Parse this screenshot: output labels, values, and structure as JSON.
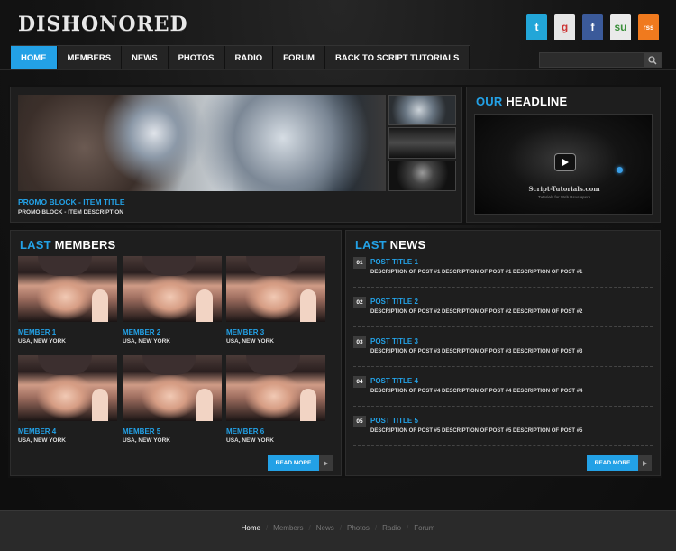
{
  "header": {
    "logo": "DISHONORED",
    "social": [
      {
        "name": "twitter",
        "glyph": "t",
        "color": "#22a6d8"
      },
      {
        "name": "google",
        "glyph": "g",
        "color": "#e6e6e6"
      },
      {
        "name": "facebook",
        "glyph": "f",
        "color": "#3b5a9a"
      },
      {
        "name": "stumbleupon",
        "glyph": "su",
        "color": "#eaeaea"
      },
      {
        "name": "rss",
        "glyph": "rss",
        "color": "#f07a1e"
      }
    ]
  },
  "nav": {
    "items": [
      "HOME",
      "MEMBERS",
      "NEWS",
      "PHOTOS",
      "RADIO",
      "FORUM",
      "BACK TO SCRIPT TUTORIALS"
    ],
    "active": "HOME"
  },
  "search": {
    "value": "",
    "placeholder": ""
  },
  "promo": {
    "title": "PROMO BLOCK - ITEM TITLE",
    "description": "PROMO BLOCK - ITEM DESCRIPTION"
  },
  "headline": {
    "title_accent": "OUR",
    "title_rest": "HEADLINE",
    "video_brand": "Script-Tutorials.com",
    "video_sub": "Tutorials for Web Developers"
  },
  "members": {
    "title_accent": "LAST",
    "title_rest": "MEMBERS",
    "items": [
      {
        "name": "MEMBER 1",
        "location": "USA, NEW YORK"
      },
      {
        "name": "MEMBER 2",
        "location": "USA, NEW YORK"
      },
      {
        "name": "MEMBER 3",
        "location": "USA, NEW YORK"
      },
      {
        "name": "MEMBER 4",
        "location": "USA, NEW YORK"
      },
      {
        "name": "MEMBER 5",
        "location": "USA, NEW YORK"
      },
      {
        "name": "MEMBER 6",
        "location": "USA, NEW YORK"
      }
    ],
    "read_more": "READ MORE"
  },
  "news": {
    "title_accent": "LAST",
    "title_rest": "NEWS",
    "items": [
      {
        "num": "01",
        "title": "POST TITLE 1",
        "desc": "DESCRIPTION OF POST #1 DESCRIPTION OF POST #1 DESCRIPTION OF POST #1"
      },
      {
        "num": "02",
        "title": "POST TITLE 2",
        "desc": "DESCRIPTION OF POST #2 DESCRIPTION OF POST #2 DESCRIPTION OF POST #2"
      },
      {
        "num": "03",
        "title": "POST TITLE 3",
        "desc": "DESCRIPTION OF POST #3 DESCRIPTION OF POST #3 DESCRIPTION OF POST #3"
      },
      {
        "num": "04",
        "title": "POST TITLE 4",
        "desc": "DESCRIPTION OF POST #4 DESCRIPTION OF POST #4 DESCRIPTION OF POST #4"
      },
      {
        "num": "05",
        "title": "POST TITLE 5",
        "desc": "DESCRIPTION OF POST #5 DESCRIPTION OF POST #5 DESCRIPTION OF POST #5"
      }
    ],
    "read_more": "READ MORE"
  },
  "footer": {
    "links": [
      "Home",
      "Members",
      "News",
      "Photos",
      "Radio",
      "Forum"
    ],
    "active": "Home"
  },
  "colors": {
    "accent": "#23a1e6",
    "background": "#101010",
    "panel": "#1e1e1e"
  }
}
